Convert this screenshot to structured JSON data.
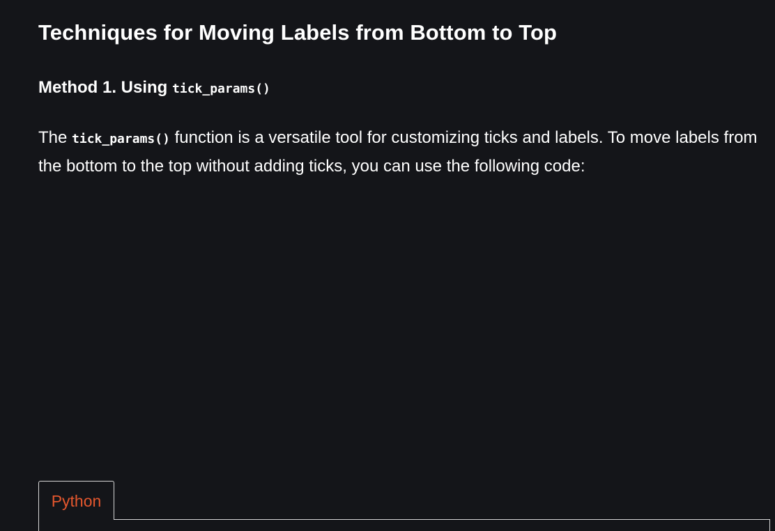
{
  "article": {
    "title": "Techniques for Moving Labels from Bottom to Top",
    "method_heading": {
      "prefix": "Method 1. Using",
      "code": "tick_params()"
    },
    "intro": {
      "before_code": "The",
      "code": "tick_params()",
      "after_code": "function is a versatile tool for customizing ticks and labels. To move labels from the bottom to the top without adding ticks, you can use the following code:"
    }
  },
  "code_block": {
    "tabs": [
      {
        "label": "Python",
        "active": true
      }
    ],
    "accent_color": "#e4572e"
  },
  "colors": {
    "background": "#141519",
    "text": "#ffffff",
    "border": "#d8d8d8"
  }
}
